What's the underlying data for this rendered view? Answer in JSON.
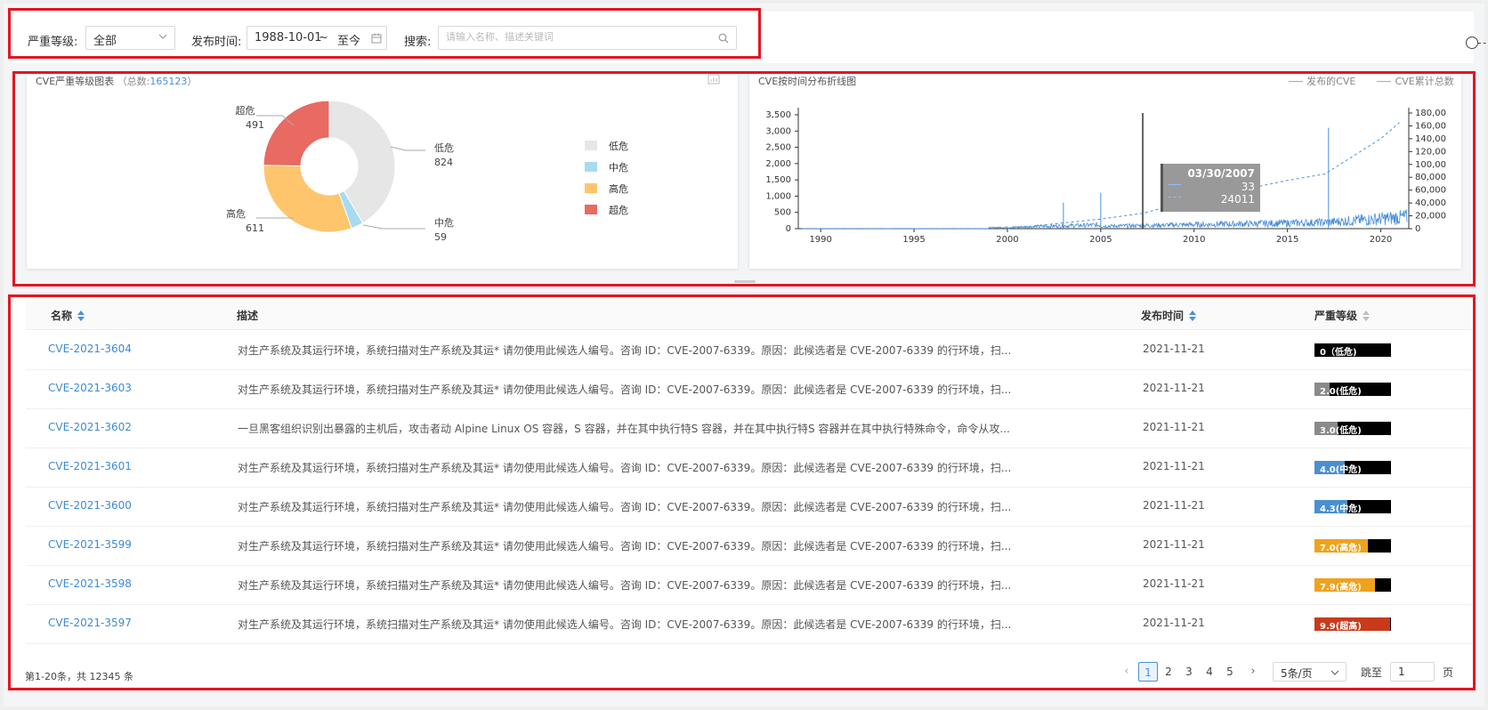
{
  "filters": {
    "severity_label": "严重等级:",
    "severity_value": "全部",
    "date_label": "发布时间:",
    "date_start": "1988-10-01",
    "date_sep": "~",
    "date_end": "至今",
    "search_label": "搜索:",
    "search_placeholder": "请输入名称、描述关键词"
  },
  "pie_panel": {
    "title": "CVE严重等级图表",
    "total_prefix": "（总数:",
    "total_value": "165123",
    "total_suffix": "）",
    "labels": [
      {
        "name": "超危",
        "value": "491"
      },
      {
        "name": "低危",
        "value": "824"
      },
      {
        "name": "高危",
        "value": "611"
      },
      {
        "name": "中危",
        "value": "59"
      }
    ],
    "legend": [
      {
        "name": "低危",
        "color": "#e6e6e6"
      },
      {
        "name": "中危",
        "color": "#a8dbef"
      },
      {
        "name": "高危",
        "color": "#ffc56d"
      },
      {
        "name": "超危",
        "color": "#e86a62"
      }
    ]
  },
  "line_panel": {
    "title": "CVE按时间分布折线图",
    "legend": [
      "发布的CVE",
      "CVE累计总数"
    ],
    "tooltip": {
      "date": "03/30/2007",
      "v1": "33",
      "v2": "24011"
    },
    "y_left_ticks": [
      "3,500",
      "3,000",
      "2,500",
      "2,000",
      "1,500",
      "1,000",
      "500",
      "0"
    ],
    "y_right_ticks": [
      "180,00",
      "160,00",
      "140,00",
      "120,00",
      "100,00",
      "80,000",
      "60,000",
      "40,000",
      "20,000",
      "0"
    ],
    "x_ticks": [
      "1990",
      "1995",
      "2000",
      "2005",
      "2010",
      "2015",
      "2020"
    ]
  },
  "chart_data": [
    {
      "type": "pie",
      "title": "CVE严重等级图表",
      "categories": [
        "低危",
        "中危",
        "高危",
        "超危"
      ],
      "values": [
        824,
        59,
        611,
        491
      ]
    },
    {
      "type": "line",
      "title": "CVE按时间分布折线图",
      "series": [
        {
          "name": "发布的CVE",
          "x": [
            1990,
            2003,
            2005,
            2007.25,
            2017.2,
            2021
          ],
          "values": [
            0,
            800,
            1100,
            33,
            3100,
            200
          ]
        },
        {
          "name": "CVE累计总数",
          "x": [
            2000,
            2005,
            2007.25,
            2010,
            2015,
            2017,
            2020,
            2021
          ],
          "values": [
            0,
            15000,
            24011,
            45000,
            75000,
            85000,
            140000,
            165123
          ]
        }
      ],
      "ylim_left": [
        0,
        3500
      ],
      "ylim_right": [
        0,
        180000
      ],
      "xlim": [
        1988.8,
        2021.5
      ]
    }
  ],
  "table": {
    "headers": {
      "name": "名称",
      "desc": "描述",
      "date": "发布时间",
      "severity": "严重等级"
    },
    "rows": [
      {
        "name": "CVE-2021-3604",
        "desc": "对生产系统及其运行环境，系统扫描对生产系统及其运* 请勿使用此候选人编号。咨询 ID：CVE-2007-6339。原因：此候选者是 CVE-2007-6339 的行环境，扫...",
        "date": "2021-11-21",
        "sev": "0（低危)",
        "level": 0.0,
        "color": "#000000"
      },
      {
        "name": "CVE-2021-3603",
        "desc": "对生产系统及其运行环境，系统扫描对生产系统及其运* 请勿使用此候选人编号。咨询 ID：CVE-2007-6339。原因：此候选者是 CVE-2007-6339 的行环境，扫...",
        "date": "2021-11-21",
        "sev": "2.0(低危)",
        "level": 2.0,
        "color": "#8a8a8a"
      },
      {
        "name": "CVE-2021-3602",
        "desc": "一旦黑客组织识别出暴露的主机后，攻击者动 Alpine Linux OS 容器，S 容器，并在其中执行特S 容器，并在其中执行特S 容器并在其中执行特殊命令，命令从攻...",
        "date": "2021-11-21",
        "sev": "3.0(低危)",
        "level": 3.0,
        "color": "#8a8a8a"
      },
      {
        "name": "CVE-2021-3601",
        "desc": "对生产系统及其运行环境，系统扫描对生产系统及其运* 请勿使用此候选人编号。咨询 ID：CVE-2007-6339。原因：此候选者是 CVE-2007-6339 的行环境，扫...",
        "date": "2021-11-21",
        "sev": "4.0(中危)",
        "level": 4.0,
        "color": "#4a8fd1"
      },
      {
        "name": "CVE-2021-3600",
        "desc": "对生产系统及其运行环境，系统扫描对生产系统及其运* 请勿使用此候选人编号。咨询 ID：CVE-2007-6339。原因：此候选者是 CVE-2007-6339 的行环境，扫...",
        "date": "2021-11-21",
        "sev": "4.3(中危)",
        "level": 4.3,
        "color": "#4a8fd1"
      },
      {
        "name": "CVE-2021-3599",
        "desc": "对生产系统及其运行环境，系统扫描对生产系统及其运* 请勿使用此候选人编号。咨询 ID：CVE-2007-6339。原因：此候选者是 CVE-2007-6339 的行环境，扫...",
        "date": "2021-11-21",
        "sev": "7.0(高危)",
        "level": 7.0,
        "color": "#f0a21c"
      },
      {
        "name": "CVE-2021-3598",
        "desc": "对生产系统及其运行环境，系统扫描对生产系统及其运* 请勿使用此候选人编号。咨询 ID：CVE-2007-6339。原因：此候选者是 CVE-2007-6339 的行环境，扫...",
        "date": "2021-11-21",
        "sev": "7.9(高危)",
        "level": 7.9,
        "color": "#f0a21c"
      },
      {
        "name": "CVE-2021-3597",
        "desc": "对生产系统及其运行环境，系统扫描对生产系统及其运* 请勿使用此候选人编号。咨询 ID：CVE-2007-6339。原因：此候选者是 CVE-2007-6339 的行环境，扫...",
        "date": "2021-11-21",
        "sev": "9.9(超高)",
        "level": 9.9,
        "color": "#c93a1b"
      }
    ]
  },
  "pagination": {
    "info": "第1-20条，共 12345 条",
    "pages": [
      "1",
      "2",
      "3",
      "4",
      "5"
    ],
    "current": "1",
    "page_size": "5条/页",
    "jump_label": "跳至",
    "jump_value": "1",
    "jump_suffix": "页"
  }
}
